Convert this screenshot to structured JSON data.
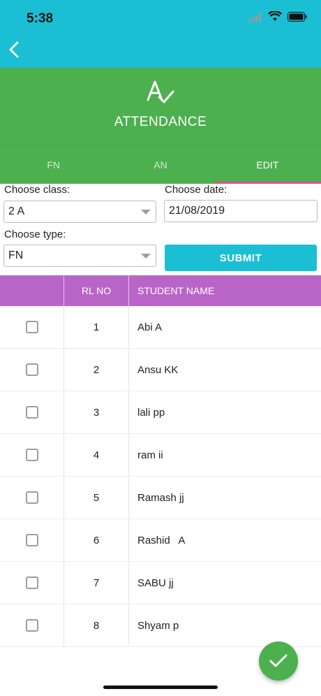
{
  "status_bar": {
    "time": "5:38",
    "icons": [
      "signal-icon",
      "wifi-icon",
      "battery-icon"
    ]
  },
  "nav": {
    "back_icon": "chevron-left-icon"
  },
  "header": {
    "logo_icon": "attendance-logo-icon",
    "title": "ATTENDANCE"
  },
  "tabs": [
    {
      "label": "FN",
      "active": false
    },
    {
      "label": "AN",
      "active": false
    },
    {
      "label": "EDIT",
      "active": true
    }
  ],
  "form": {
    "class_label": "Choose class:",
    "class_value": "2 A",
    "date_label": "Choose date:",
    "date_value": "21/08/2019",
    "type_label": "Choose type:",
    "type_value": "FN",
    "submit_label": "SUBMIT"
  },
  "table": {
    "headers": {
      "check": "",
      "rl_no": "RL NO",
      "name": "STUDENT NAME"
    },
    "rows": [
      {
        "rl_no": "1",
        "name": "Abi A",
        "checked": false
      },
      {
        "rl_no": "2",
        "name": "Ansu KK",
        "checked": false
      },
      {
        "rl_no": "3",
        "name": "lali pp",
        "checked": false
      },
      {
        "rl_no": "4",
        "name": "ram ii",
        "checked": false
      },
      {
        "rl_no": "5",
        "name": "Ramash jj",
        "checked": false
      },
      {
        "rl_no": "6",
        "name": "Rashid   A",
        "checked": false
      },
      {
        "rl_no": "7",
        "name": "SABU jj",
        "checked": false
      },
      {
        "rl_no": "8",
        "name": "Shyam p",
        "checked": false
      }
    ]
  },
  "fab": {
    "icon": "checkmark-icon"
  },
  "colors": {
    "nav_bar": "#1bbfd3",
    "header": "#4cb04f",
    "tab_indicator": "#e0508a",
    "table_header": "#b965c7",
    "submit_button": "#1bbfd3",
    "fab": "#4cb04f"
  }
}
